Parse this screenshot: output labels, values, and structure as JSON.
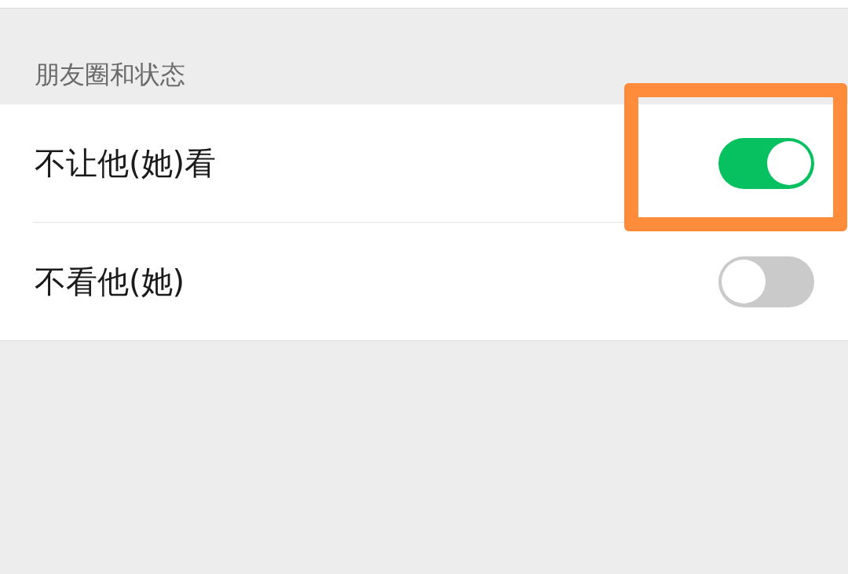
{
  "section": {
    "title": "朋友圈和状态"
  },
  "rows": [
    {
      "label": "不让他(她)看",
      "on": true,
      "highlighted": true
    },
    {
      "label": "不看他(她)",
      "on": false,
      "highlighted": false
    }
  ]
}
